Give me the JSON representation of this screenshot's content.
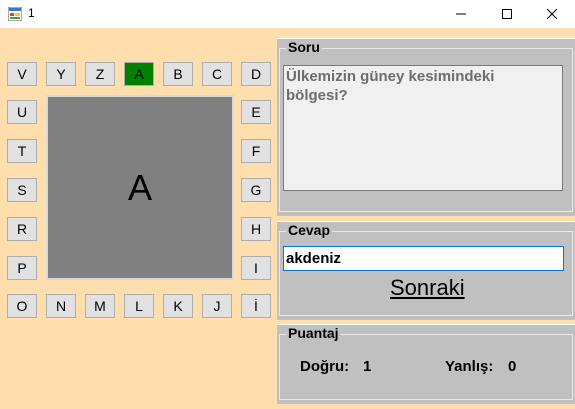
{
  "window": {
    "title": "1",
    "icon": "app-form-icon",
    "controls": [
      "minimize-icon",
      "maximize-icon",
      "close-icon"
    ]
  },
  "letters": {
    "top": [
      "V",
      "Y",
      "Z",
      "A",
      "B",
      "C",
      "D"
    ],
    "left": [
      "U",
      "T",
      "S",
      "R",
      "P"
    ],
    "right": [
      "E",
      "F",
      "G",
      "H",
      "I"
    ],
    "bottom": [
      "O",
      "N",
      "M",
      "L",
      "K",
      "J",
      "İ"
    ],
    "active_letter": "A",
    "active_color": "#008000"
  },
  "display": {
    "letter": "A"
  },
  "soru": {
    "title": "Soru",
    "question": "Ülkemizin güney kesimindeki bölgesi?"
  },
  "cevap": {
    "title": "Cevap",
    "value": "akdeniz",
    "next_label": "Sonraki"
  },
  "puantaj": {
    "title": "Puantaj",
    "dogru_label": "Doğru:",
    "dogru_value": "1",
    "yanlis_label": "Yanlış:",
    "yanlis_value": "0"
  }
}
